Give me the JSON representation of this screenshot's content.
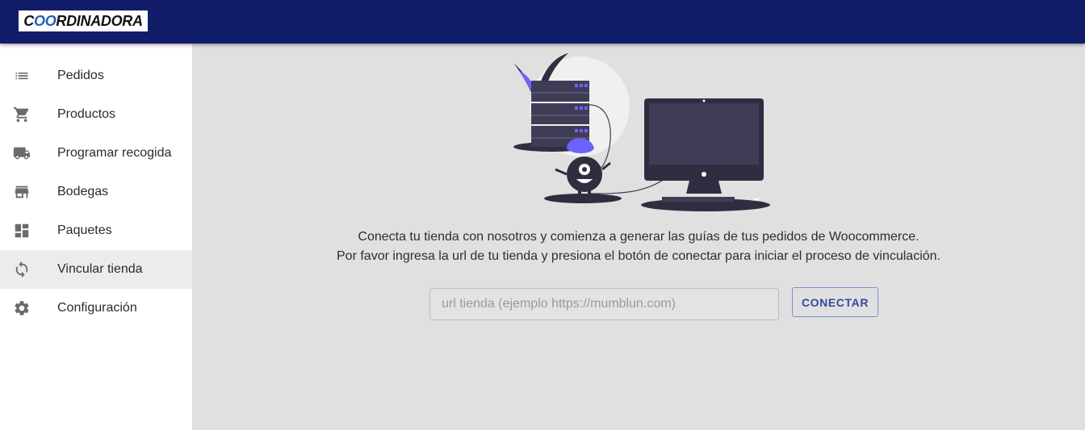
{
  "header": {
    "logo_prefix": "C",
    "logo_oo": "OO",
    "logo_suffix": "RDINADORA",
    "background": "#121d69"
  },
  "sidebar": {
    "items": [
      {
        "label": "Pedidos",
        "icon": "list-icon",
        "active": false
      },
      {
        "label": "Productos",
        "icon": "cart-icon",
        "active": false
      },
      {
        "label": "Programar recogida",
        "icon": "truck-icon",
        "active": false
      },
      {
        "label": "Bodegas",
        "icon": "store-icon",
        "active": false
      },
      {
        "label": "Paquetes",
        "icon": "dashboard-icon",
        "active": false
      },
      {
        "label": "Vincular tienda",
        "icon": "sync-icon",
        "active": true
      },
      {
        "label": "Configuración",
        "icon": "gear-icon",
        "active": false
      }
    ]
  },
  "main": {
    "message_line1": "Conecta tu tienda con nosotros y comienza a generar las guías de tus pedidos de Woocommerce.",
    "message_line2": "Por favor ingresa la url de tu tienda y presiona el botón de conectar para iniciar el proceso de vinculación.",
    "url_input": {
      "value": "",
      "placeholder": "url tienda (ejemplo https://mumblun.com)"
    },
    "connect_label": "CONECTAR",
    "accent": "#3347a0",
    "illustration_accent": "#6c63ff"
  }
}
